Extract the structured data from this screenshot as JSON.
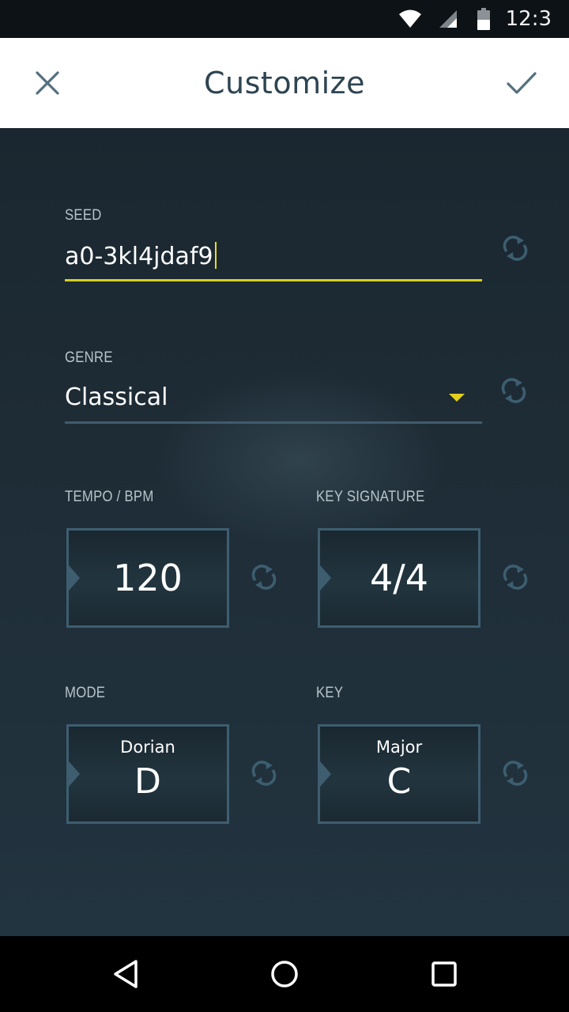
{
  "status_bar": {
    "time": "12:3",
    "icons": [
      "wifi-icon",
      "signal-icon",
      "battery-icon"
    ]
  },
  "app_bar": {
    "title": "Customize",
    "close_icon": "close-icon",
    "confirm_icon": "check-icon"
  },
  "form": {
    "seed": {
      "label": "SEED",
      "value": "a0-3kl4jdaf9"
    },
    "genre": {
      "label": "GENRE",
      "value": "Classical"
    },
    "tempo": {
      "label": "TEMPO / BPM",
      "value": "120"
    },
    "key_signature": {
      "label": "KEY SIGNATURE",
      "value": "4/4"
    },
    "mode": {
      "label": "MODE",
      "sub": "Dorian",
      "value": "D"
    },
    "key": {
      "label": "KEY",
      "sub": "Major",
      "value": "C"
    }
  },
  "nav_bar": {
    "icons": [
      "back-icon",
      "home-icon",
      "recents-icon"
    ]
  },
  "colors": {
    "accent": "#d8cf1f",
    "box_border": "#3e5e70",
    "background": "#1d2a33",
    "app_bar_text": "#2e4451"
  }
}
